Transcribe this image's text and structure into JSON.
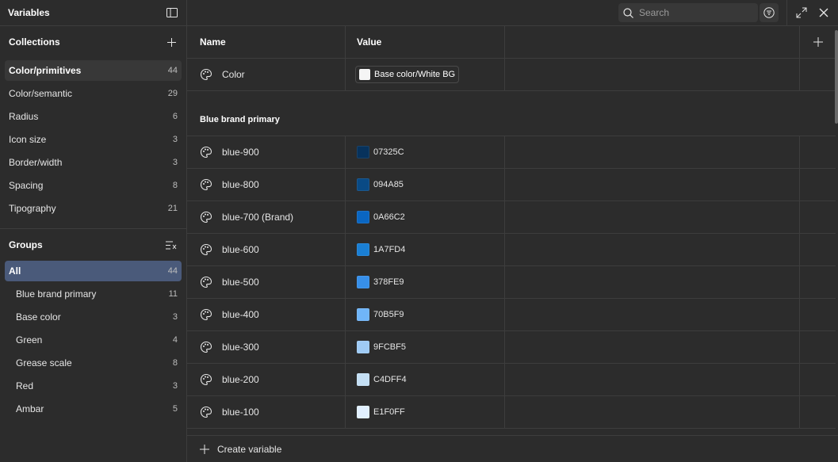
{
  "sidebar": {
    "title": "Variables",
    "collections_label": "Collections",
    "collections": [
      {
        "name": "Color/primitives",
        "count": "44",
        "selected": true
      },
      {
        "name": "Color/semantic",
        "count": "29"
      },
      {
        "name": "Radius",
        "count": "6"
      },
      {
        "name": "Icon size",
        "count": "3"
      },
      {
        "name": "Border/width",
        "count": "3"
      },
      {
        "name": "Spacing",
        "count": "8"
      },
      {
        "name": "Tipography",
        "count": "21"
      }
    ],
    "groups_label": "Groups",
    "groups": [
      {
        "name": "All",
        "count": "44",
        "selected": true
      },
      {
        "name": "Blue brand primary",
        "count": "11"
      },
      {
        "name": "Base color",
        "count": "3"
      },
      {
        "name": "Green",
        "count": "4"
      },
      {
        "name": "Grease scale",
        "count": "8"
      },
      {
        "name": "Red",
        "count": "3"
      },
      {
        "name": "Ambar",
        "count": "5"
      }
    ]
  },
  "topbar": {
    "search_placeholder": "Search"
  },
  "table": {
    "header_name": "Name",
    "header_value": "Value",
    "top_variable": {
      "name": "Color",
      "alias": "Base color/White BG",
      "color": "#f5f5f5"
    },
    "group_title": "Blue brand primary",
    "variables": [
      {
        "name": "blue-900",
        "hex": "07325C",
        "color": "#07325C"
      },
      {
        "name": "blue-800",
        "hex": "094A85",
        "color": "#094A85"
      },
      {
        "name": "blue-700 (Brand)",
        "hex": "0A66C2",
        "color": "#0A66C2"
      },
      {
        "name": "blue-600",
        "hex": "1A7FD4",
        "color": "#1A7FD4"
      },
      {
        "name": "blue-500",
        "hex": "378FE9",
        "color": "#378FE9"
      },
      {
        "name": "blue-400",
        "hex": "70B5F9",
        "color": "#70B5F9"
      },
      {
        "name": "blue-300",
        "hex": "9FCBF5",
        "color": "#9FCBF5"
      },
      {
        "name": "blue-200",
        "hex": "C4DFF4",
        "color": "#C4DFF4"
      },
      {
        "name": "blue-100",
        "hex": "E1F0FF",
        "color": "#E1F0FF"
      }
    ]
  },
  "footer": {
    "create_label": "Create variable"
  }
}
